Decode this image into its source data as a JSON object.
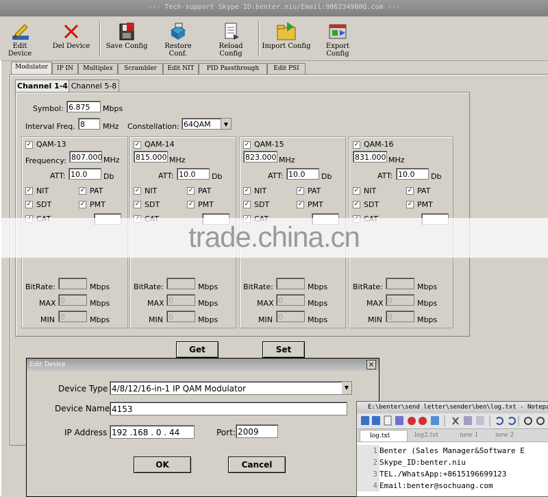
{
  "window_title": "--- Tech-support Skype ID:benter.niu/Email:986234980Q.com ---",
  "toolbar": {
    "edit_device": "Edit Device",
    "del_device": "Del Device",
    "save_config": "Save Config",
    "restore_conf": "Restore Conf.",
    "reload_config": "Reload Config",
    "import_config": "Import Config",
    "export_config": "Export Config"
  },
  "main_tabs": [
    "Modulator",
    "IP IN",
    "Multiplex",
    "Scrambler",
    "Edit NIT",
    "PID Passthrough",
    "Edit PSI"
  ],
  "channel_tabs": [
    "Channel 1-4",
    "Channel 5-8"
  ],
  "global": {
    "symbol_label": "Symbol:",
    "symbol_value": "6.875",
    "symbol_unit": "Mbps",
    "interval_label": "Interval Freq.",
    "interval_value": "8",
    "interval_unit": "MHz",
    "constellation_label": "Constellation:",
    "constellation_value": "64QAM"
  },
  "channels": [
    {
      "name": "QAM-13",
      "freq_label": "Frequency:",
      "freq": "807.000",
      "freq_unit": "MHz",
      "att_label": "ATT:",
      "att": "10.0",
      "att_unit": "Db",
      "nit": "NIT",
      "pat": "PAT",
      "sdt": "SDT",
      "pmt": "PMT",
      "cat": "CAT",
      "bitrate_label": "BitRate:",
      "max_label": "MAX",
      "min_label": "MIN",
      "max_val": "0",
      "min_val": "0",
      "unit": "Mbps"
    },
    {
      "name": "QAM-14",
      "freq": "815.000",
      "freq_unit": "MHz",
      "att_label": "ATT:",
      "att": "10.0",
      "att_unit": "Db",
      "nit": "NIT",
      "pat": "PAT",
      "sdt": "SDT",
      "pmt": "PMT",
      "cat": "CAT",
      "bitrate_label": "BitRate:",
      "max_label": "MAX",
      "min_label": "MIN",
      "max_val": "0",
      "min_val": "0",
      "unit": "Mbps"
    },
    {
      "name": "QAM-15",
      "freq": "823.000",
      "freq_unit": "MHz",
      "att_label": "ATT:",
      "att": "10.0",
      "att_unit": "Db",
      "nit": "NIT",
      "pat": "PAT",
      "sdt": "SDT",
      "pmt": "PMT",
      "cat": "CAT",
      "bitrate_label": "BitRate:",
      "max_label": "MAX",
      "min_label": "MIN",
      "max_val": "0",
      "min_val": "0",
      "unit": "Mbps"
    },
    {
      "name": "QAM-16",
      "freq": "831.000",
      "freq_unit": "MHz",
      "att_label": "ATT:",
      "att": "10.0",
      "att_unit": "Db",
      "nit": "NIT",
      "pat": "PAT",
      "sdt": "SDT",
      "pmt": "PMT",
      "cat": "CAT",
      "bitrate_label": "BitRate:",
      "max_label": "MAX",
      "min_label": "MIN",
      "max_val": "0",
      "min_val": "0",
      "unit": "Mbps"
    }
  ],
  "actions": {
    "get": "Get",
    "set": "Set"
  },
  "watermark": "trade.china.cn",
  "dialog": {
    "title": "Edit Device",
    "close": "×",
    "device_type_label": "Device Type",
    "device_type_value": "4/8/12/16-in-1 IP QAM Modulator",
    "device_name_label": "Device Name",
    "device_name_value": "4153",
    "ip_label": "IP Address",
    "ip_value": "192 .168 . 0 . 44",
    "port_label": "Port:",
    "port_value": "2009",
    "ok": "OK",
    "cancel": "Cancel"
  },
  "notepad": {
    "title": "E:\\benter\\send letter\\sender\\ben\\log.txt - Notepad++",
    "tabs": [
      "log.txt",
      "log2.txt",
      "new 1",
      "new 2"
    ],
    "lines": [
      {
        "n": "1",
        "text": "Benter (Sales Manager&Software E"
      },
      {
        "n": "2",
        "text": "Skype_ID:benter.niu"
      },
      {
        "n": "3",
        "text": "TEL./WhatsApp:+8615196699123"
      },
      {
        "n": "4",
        "text": "Email:benter@sochuang.com"
      }
    ]
  },
  "colors": {
    "window_bg": "#d4d0c8",
    "checkbox_check": "#000000",
    "icon_red": "#d01010"
  }
}
